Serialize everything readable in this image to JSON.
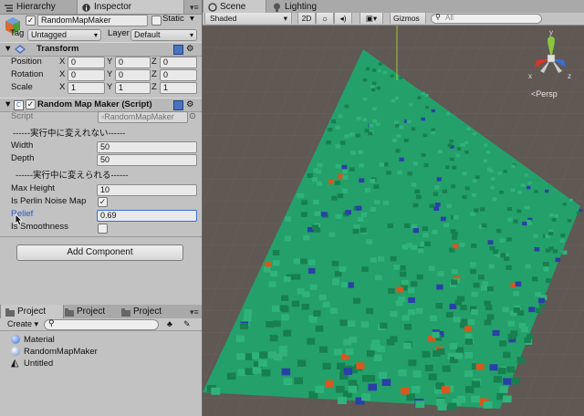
{
  "left_tabs": {
    "hierarchy": "Hierarchy",
    "inspector": "Inspector"
  },
  "object": {
    "name": "RandomMapMaker",
    "static_label": "Static",
    "tag_label": "Tag",
    "tag_value": "Untagged",
    "layer_label": "Layer",
    "layer_value": "Default"
  },
  "transform": {
    "title": "Transform",
    "position": {
      "label": "Position",
      "x": "0",
      "y": "0",
      "z": "0"
    },
    "rotation": {
      "label": "Rotation",
      "x": "0",
      "y": "0",
      "z": "0"
    },
    "scale": {
      "label": "Scale",
      "x": "1",
      "y": "1",
      "z": "1"
    },
    "axis_x": "X",
    "axis_y": "Y",
    "axis_z": "Z"
  },
  "script_component": {
    "title": "Random Map Maker (Script)",
    "script_label": "Script",
    "script_value": "RandomMapMaker",
    "section1": "------実行中に変えれない------",
    "width_label": "Width",
    "width_value": "50",
    "depth_label": "Depth",
    "depth_value": "50",
    "section2": "------実行中に変えられる------",
    "maxheight_label": "Max Height",
    "maxheight_value": "10",
    "perlin_label": "Is Perlin Noise Map",
    "perlin_checked": true,
    "relief_label": "Relief",
    "relief_value": "0.69",
    "smooth_label": "Is Smoothness",
    "smooth_checked": false
  },
  "add_component": "Add Component",
  "project_tabs": [
    "Project",
    "Project",
    "Project"
  ],
  "project": {
    "create_label": "Create",
    "search_placeholder": "",
    "items": [
      "Material",
      "RandomMapMaker",
      "Untitled"
    ]
  },
  "scene_tabs": {
    "scene": "Scene",
    "lighting": "Lighting"
  },
  "scene_toolbar": {
    "shading": "Shaded",
    "mode_2d": "2D",
    "gizmos": "Gizmos",
    "search_placeholder": "All"
  },
  "gizmo": {
    "persp_label": "Persp",
    "axis_y": "y",
    "axis_x": "x",
    "axis_z": "z"
  },
  "colors": {
    "terrain_green": "#1f9e63",
    "terrain_blue": "#2a3fa8",
    "terrain_orange": "#d9561c",
    "scene_bg": "#605a55",
    "selection": "#3a6fd8"
  }
}
